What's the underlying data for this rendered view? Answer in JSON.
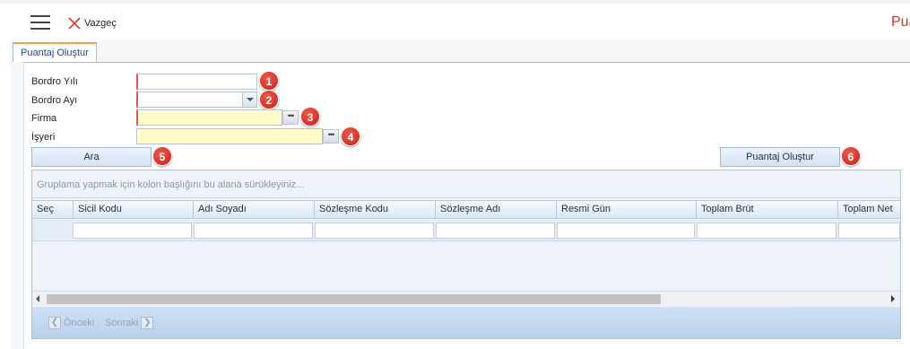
{
  "toolbar": {
    "menu_icon": "hamburger-menu-icon",
    "cancel_label": "Vazgeç",
    "cancel_icon": "close-x-icon",
    "title": "Pua"
  },
  "tab": {
    "label": "Puantaj Oluştur"
  },
  "form": {
    "year_label": "Bordro Yılı",
    "month_label": "Bordro Ayı",
    "company_label": "Firma",
    "workplace_label": "İşyeri",
    "year_value": "",
    "month_value": "",
    "company_value": "",
    "workplace_value": "",
    "dots": "•••"
  },
  "badges": [
    "1",
    "2",
    "3",
    "4",
    "5",
    "6"
  ],
  "buttons": {
    "search": "Ara",
    "create": "Puantaj Oluştur"
  },
  "grid": {
    "group_hint": "Gruplama yapmak için kolon başlığını bu alana sürükleyiniz...",
    "columns": [
      "Seç",
      "Sicil Kodu",
      "Adı Soyadı",
      "Sözleşme Kodu",
      "Sözleşme Adı",
      "Resmi Gün",
      "Toplam Brüt",
      "Toplam Net"
    ]
  },
  "pager": {
    "prev": "Önceki",
    "next": "Sonraki"
  },
  "colors": {
    "accent_red": "#c0392b",
    "badge_red": "#d9251d",
    "required_yellow": "#fffcc9",
    "header_blue": "#dbe8f6"
  }
}
